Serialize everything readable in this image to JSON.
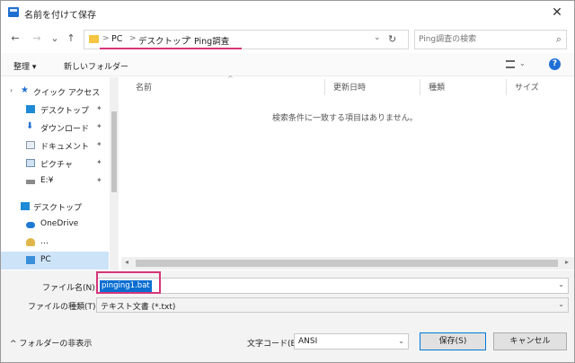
{
  "window": {
    "title": "名前を付けて保存",
    "close_glyph": "✕"
  },
  "nav": {
    "back_glyph": "←",
    "forward_glyph": "→",
    "recent_glyph": "⌄",
    "up_glyph": "↑",
    "breadcrumbs": [
      "PC",
      "デスクトップ",
      "Ping調査"
    ],
    "crumb_separator": ">",
    "refresh_glyph": "↻",
    "search_placeholder": "Ping調査の検索",
    "search_glyph": "⌕"
  },
  "toolbar": {
    "organize_label": "整理 ▾",
    "new_folder_label": "新しいフォルダー",
    "help_glyph": "?"
  },
  "sidebar": {
    "items": [
      {
        "label": "クイック アクセス",
        "icon": "star-icon",
        "pinned": false
      },
      {
        "label": "デスクトップ",
        "icon": "desktop-icon",
        "pinned": true
      },
      {
        "label": "ダウンロード",
        "icon": "download-icon",
        "pinned": true
      },
      {
        "label": "ドキュメント",
        "icon": "document-icon",
        "pinned": true
      },
      {
        "label": "ピクチャ",
        "icon": "picture-icon",
        "pinned": true
      },
      {
        "label": "E:¥",
        "icon": "drive-icon",
        "pinned": true
      },
      {
        "label": "デスクトップ",
        "icon": "desktop-icon",
        "pinned": false
      },
      {
        "label": "OneDrive",
        "icon": "cloud-icon",
        "pinned": false
      },
      {
        "label": "…",
        "icon": "user-icon",
        "pinned": false
      },
      {
        "label": "PC",
        "icon": "pc-icon",
        "pinned": false
      }
    ],
    "pin_glyph": "✦",
    "expand_glyph": "›"
  },
  "filelist": {
    "columns": [
      "名前",
      "更新日時",
      "種類",
      "サイズ"
    ],
    "sort_glyph": "^",
    "empty_message": "検索条件に一致する項目はありません。"
  },
  "form": {
    "filename_label": "ファイル名(N):",
    "filename_value": "pinging1.bat",
    "filetype_label": "ファイルの種類(T):",
    "filetype_value": "テキスト文書 (*.txt)",
    "chevron_glyph": "⌄"
  },
  "footer": {
    "hide_folders_label": "^ フォルダーの非表示",
    "encoding_label": "文字コード(E):",
    "encoding_value": "ANSI",
    "save_label": "保存(S)",
    "cancel_label": "キャンセル"
  },
  "colors": {
    "accent": "#0078d7",
    "selection": "#0a6ed1",
    "annotation_pink": "#d6367a",
    "sidebar_selected": "#cde3f7"
  }
}
